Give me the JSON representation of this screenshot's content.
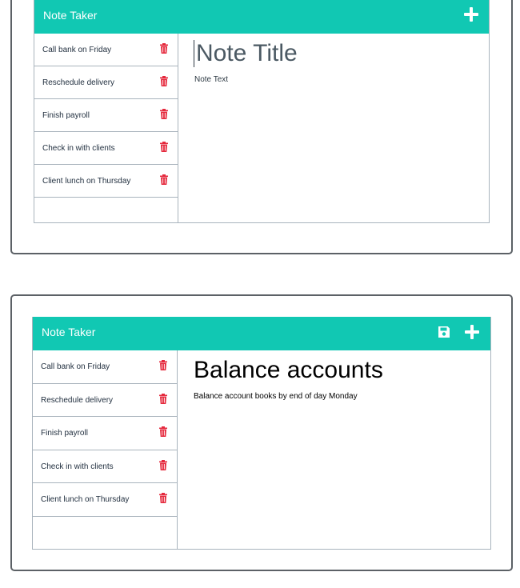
{
  "colors": {
    "navbar": "#11c8b3",
    "trash": "#e5293d",
    "border": "#a9b3bd"
  },
  "screens": [
    {
      "navbar": {
        "brand": "Note Taker",
        "new_note_icon": "plus-icon"
      },
      "notes": [
        {
          "title": "Call bank on Friday",
          "delete_icon": "trash-icon"
        },
        {
          "title": "Reschedule delivery",
          "delete_icon": "trash-icon"
        },
        {
          "title": "Finish payroll",
          "delete_icon": "trash-icon"
        },
        {
          "title": "Check in with clients",
          "delete_icon": "trash-icon"
        },
        {
          "title": "Client lunch on Thursday",
          "delete_icon": "trash-icon"
        }
      ],
      "editor": {
        "title_value": "",
        "title_placeholder": "Note Title",
        "text_value": "",
        "text_placeholder": "Note Text"
      }
    },
    {
      "navbar": {
        "brand": "Note Taker",
        "save_icon": "floppy-disk-icon",
        "new_note_icon": "plus-icon"
      },
      "notes": [
        {
          "title": "Call bank on Friday",
          "delete_icon": "trash-icon"
        },
        {
          "title": "Reschedule delivery",
          "delete_icon": "trash-icon"
        },
        {
          "title": "Finish payroll",
          "delete_icon": "trash-icon"
        },
        {
          "title": "Check in with clients",
          "delete_icon": "trash-icon"
        },
        {
          "title": "Client lunch on Thursday",
          "delete_icon": "trash-icon"
        }
      ],
      "editor": {
        "title_value": "Balance accounts",
        "text_value": "Balance account books by end of day Monday"
      }
    }
  ]
}
